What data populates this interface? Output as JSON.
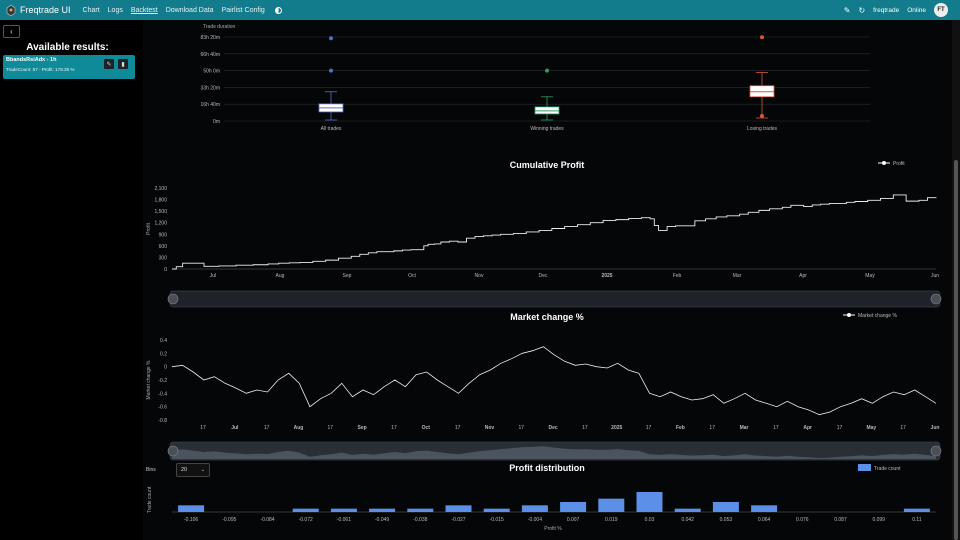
{
  "navbar": {
    "brand": "Freqtrade UI",
    "links": [
      "Chart",
      "Logs",
      "Backtest",
      "Download Data",
      "Pairlist Config"
    ],
    "active_link": "Backtest",
    "bot_name": "freqtrade",
    "status": "Online",
    "avatar": "FT",
    "icons": [
      "logo-icon",
      "theme-toggle-icon",
      "pin-icon",
      "refresh-icon"
    ],
    "color": "#127b8c"
  },
  "sidebar": {
    "back_label": "‹",
    "title": "Available results:",
    "result": {
      "name": "BbandsRsiAdx - 1h",
      "stats": "TradeCount: 57 - Profit: 178.35 %"
    }
  },
  "trade_duration": {
    "title": "Trade duration",
    "y_ticks": [
      "83h 20m",
      "66h 40m",
      "50h 0m",
      "33h 20m",
      "16h 40m",
      "0m"
    ],
    "categories": [
      "All trades",
      "Winning trades",
      "Losing trades"
    ]
  },
  "bins": {
    "label": "Bins",
    "value": "20"
  },
  "chart_data": [
    {
      "type": "boxplot",
      "title": "Trade duration",
      "ylim": [
        0,
        83.3
      ],
      "y_unit": "hours",
      "categories": [
        "All trades",
        "Winning trades",
        "Losing trades"
      ],
      "boxes": [
        {
          "min": 1,
          "q1": 9,
          "median": 13,
          "q3": 17,
          "max": 29,
          "outliers": [
            50,
            82
          ]
        },
        {
          "min": 1,
          "q1": 7,
          "median": 10,
          "q3": 14,
          "max": 24,
          "outliers": [
            50
          ]
        },
        {
          "min": 3,
          "q1": 24,
          "median": 29,
          "q3": 35,
          "max": 48,
          "outliers": [
            5,
            83
          ]
        }
      ],
      "colors": [
        "#5470c6",
        "#2e9e63",
        "#d9553e"
      ]
    },
    {
      "type": "line",
      "title": "Cumulative Profit",
      "ylabel": "Profit",
      "legend": "Profit",
      "y_ticks": [
        "2,100",
        "1,800",
        "1,500",
        "1,200",
        "900",
        "600",
        "300",
        "0"
      ],
      "ylim": [
        0,
        2100
      ],
      "x_ticks": [
        "Jul",
        "Aug",
        "Sep",
        "Oct",
        "Nov",
        "Dec",
        "2025",
        "Feb",
        "Mar",
        "Apr",
        "May",
        "Jun"
      ],
      "x": [
        0,
        2,
        5,
        10,
        15,
        22,
        30,
        38,
        45,
        50,
        55,
        60,
        66,
        72,
        78,
        84,
        88,
        92,
        96,
        100,
        104,
        108,
        112,
        115,
        118,
        120,
        123,
        126,
        130,
        134,
        138,
        142,
        146,
        150,
        154,
        160,
        166,
        172,
        178,
        184,
        190,
        196,
        202,
        208,
        214,
        220,
        224,
        226,
        228,
        232,
        236,
        240,
        245,
        250,
        255,
        260,
        266,
        270,
        275,
        280,
        286,
        290,
        296,
        300,
        304,
        308,
        312,
        316,
        320,
        326,
        332,
        338,
        344,
        350,
        354,
        358
      ],
      "y": [
        0,
        60,
        150,
        150,
        70,
        80,
        100,
        110,
        130,
        150,
        160,
        170,
        200,
        230,
        280,
        330,
        380,
        420,
        450,
        450,
        470,
        490,
        500,
        500,
        600,
        640,
        650,
        700,
        720,
        700,
        800,
        840,
        860,
        880,
        900,
        920,
        960,
        1000,
        1050,
        1100,
        1150,
        1200,
        1260,
        1280,
        1310,
        1330,
        1300,
        1130,
        1000,
        1100,
        1120,
        1120,
        1250,
        1300,
        1350,
        1380,
        1420,
        1470,
        1520,
        1560,
        1600,
        1650,
        1620,
        1660,
        1680,
        1700,
        1700,
        1730,
        1750,
        1780,
        1830,
        1920,
        1760,
        1780,
        1850,
        1860
      ]
    },
    {
      "type": "line",
      "title": "Market change %",
      "ylabel": "Market change %",
      "legend": "Market change %",
      "y_ticks": [
        "0.4",
        "0.2",
        "0",
        "-0.2",
        "-0.4",
        "-0.6",
        "-0.8"
      ],
      "ylim": [
        -0.8,
        0.4
      ],
      "x_ticks": [
        "17",
        "Jul",
        "17",
        "Aug",
        "17",
        "Sep",
        "17",
        "Oct",
        "17",
        "Nov",
        "17",
        "Dec",
        "17",
        "2025",
        "17",
        "Feb",
        "17",
        "Mar",
        "17",
        "Apr",
        "17",
        "May",
        "17",
        "Jun"
      ],
      "x": [
        0,
        5,
        10,
        15,
        20,
        25,
        30,
        35,
        40,
        45,
        50,
        55,
        60,
        65,
        70,
        75,
        80,
        85,
        90,
        95,
        100,
        105,
        110,
        115,
        120,
        125,
        130,
        135,
        140,
        145,
        150,
        155,
        160,
        165,
        170,
        175,
        180,
        185,
        190,
        195,
        200,
        205,
        210,
        215,
        220,
        225,
        230,
        235,
        240,
        245,
        250,
        255,
        260,
        265,
        270,
        275,
        280,
        285,
        290,
        295,
        300,
        305,
        310,
        315,
        320,
        325,
        330,
        335,
        340,
        345,
        350,
        355,
        360
      ],
      "y": [
        0.0,
        0.02,
        -0.08,
        -0.2,
        -0.15,
        -0.25,
        -0.32,
        -0.4,
        -0.35,
        -0.38,
        -0.2,
        -0.1,
        -0.25,
        -0.6,
        -0.48,
        -0.4,
        -0.25,
        -0.45,
        -0.35,
        -0.42,
        -0.3,
        -0.2,
        -0.3,
        -0.12,
        -0.08,
        -0.2,
        -0.3,
        -0.4,
        -0.25,
        -0.12,
        -0.05,
        0.05,
        0.12,
        0.2,
        0.24,
        0.3,
        0.18,
        0.08,
        0.02,
        0.04,
        0.0,
        -0.02,
        0.05,
        -0.05,
        -0.1,
        -0.4,
        -0.45,
        -0.38,
        -0.45,
        -0.5,
        -0.48,
        -0.42,
        -0.55,
        -0.48,
        -0.4,
        -0.5,
        -0.55,
        -0.6,
        -0.52,
        -0.6,
        -0.65,
        -0.72,
        -0.68,
        -0.6,
        -0.55,
        -0.48,
        -0.55,
        -0.45,
        -0.38,
        -0.42,
        -0.35,
        -0.45,
        -0.55
      ]
    },
    {
      "type": "bar",
      "title": "Profit distribution",
      "xlabel": "Profit %",
      "ylabel": "Trade count",
      "legend": "Trade count",
      "categories": [
        "-0.106",
        "-0.095",
        "-0.084",
        "-0.072",
        "-0.061",
        "-0.049",
        "-0.038",
        "-0.027",
        "-0.015",
        "-0.004",
        "0.007",
        "0.019",
        "0.03",
        "0.042",
        "0.053",
        "0.064",
        "0.076",
        "0.087",
        "0.099",
        "0.11"
      ],
      "values": [
        2,
        0,
        0,
        1,
        1,
        1,
        1,
        2,
        1,
        2,
        3,
        4,
        6,
        1,
        3,
        2,
        0,
        0,
        0,
        1
      ],
      "ylim": [
        0,
        6
      ],
      "color": "#5b8fe8"
    }
  ]
}
